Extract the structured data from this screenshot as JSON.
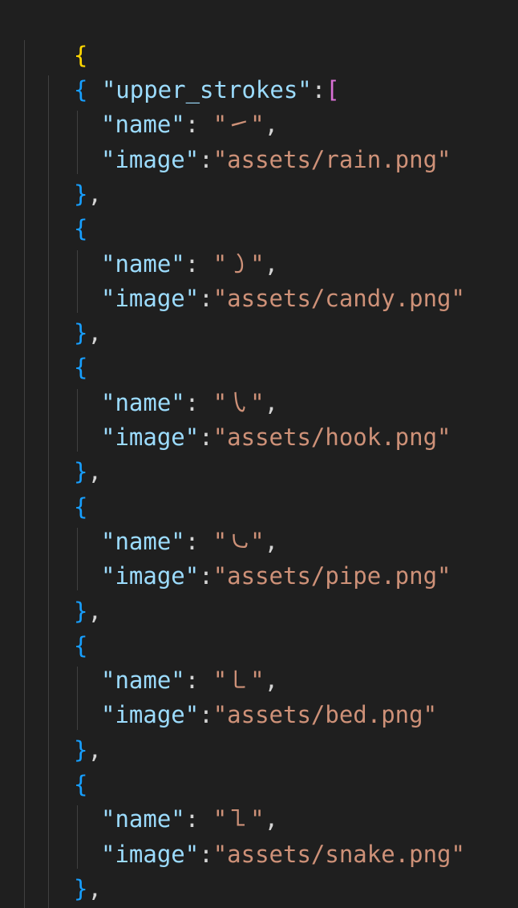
{
  "json": {
    "open_root": "{",
    "array_key": "\"upper_strokes\"",
    "array_colon": ":",
    "array_open": "[",
    "name_key": "\"name\"",
    "image_key": "\"image\"",
    "items": [
      {
        "name": "\"㇀\"",
        "image": "\"assets/rain.png\""
      },
      {
        "name": "\"㇁\"",
        "image": "\"assets/candy.png\""
      },
      {
        "name": "\"㇂\"",
        "image": "\"assets/hook.png\""
      },
      {
        "name": "\"㇃\"",
        "image": "\"assets/pipe.png\""
      },
      {
        "name": "\"㇄\"",
        "image": "\"assets/bed.png\""
      },
      {
        "name": "\"㇅\"",
        "image": "\"assets/snake.png\""
      }
    ]
  },
  "colors": {
    "background": "#1f1f1f",
    "key": "#9cdcfe",
    "string": "#ce9178",
    "brace_root": "#ffd700",
    "bracket": "#da70d6",
    "brace_object": "#179fff"
  }
}
